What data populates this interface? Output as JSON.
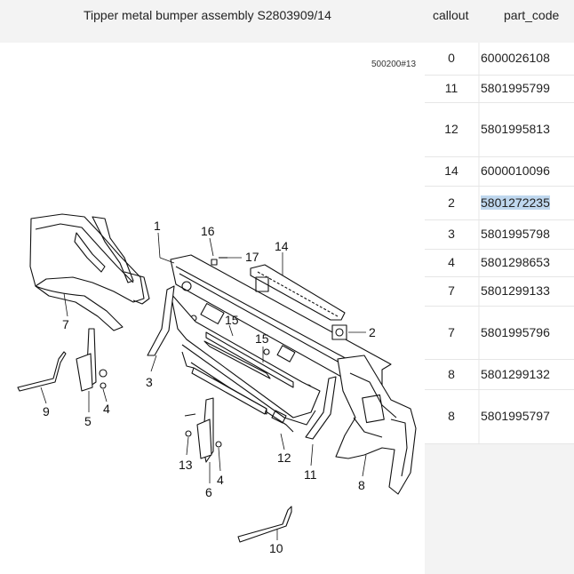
{
  "header": {
    "title": "Tipper metal bumper assembly S2803909/14",
    "col_callout": "callout",
    "col_part_code": "part_code"
  },
  "diagram": {
    "reference": "500200#13",
    "callouts": [
      "1",
      "2",
      "3",
      "4",
      "4",
      "5",
      "6",
      "7",
      "8",
      "9",
      "10",
      "11",
      "12",
      "13",
      "14",
      "15",
      "15",
      "16",
      "17"
    ]
  },
  "table": {
    "selected_row": 4,
    "rows": [
      {
        "callout": "0",
        "part_code": "6000026108"
      },
      {
        "callout": "11",
        "part_code": "5801995799"
      },
      {
        "callout": "12",
        "part_code": "5801995813"
      },
      {
        "callout": "14",
        "part_code": "6000010096"
      },
      {
        "callout": "2",
        "part_code": "5801272235"
      },
      {
        "callout": "3",
        "part_code": "5801995798"
      },
      {
        "callout": "4",
        "part_code": "5801298653"
      },
      {
        "callout": "7",
        "part_code": "5801299133"
      },
      {
        "callout": "7",
        "part_code": "5801995796"
      },
      {
        "callout": "8",
        "part_code": "5801299132"
      },
      {
        "callout": "8",
        "part_code": "5801995797"
      }
    ]
  }
}
